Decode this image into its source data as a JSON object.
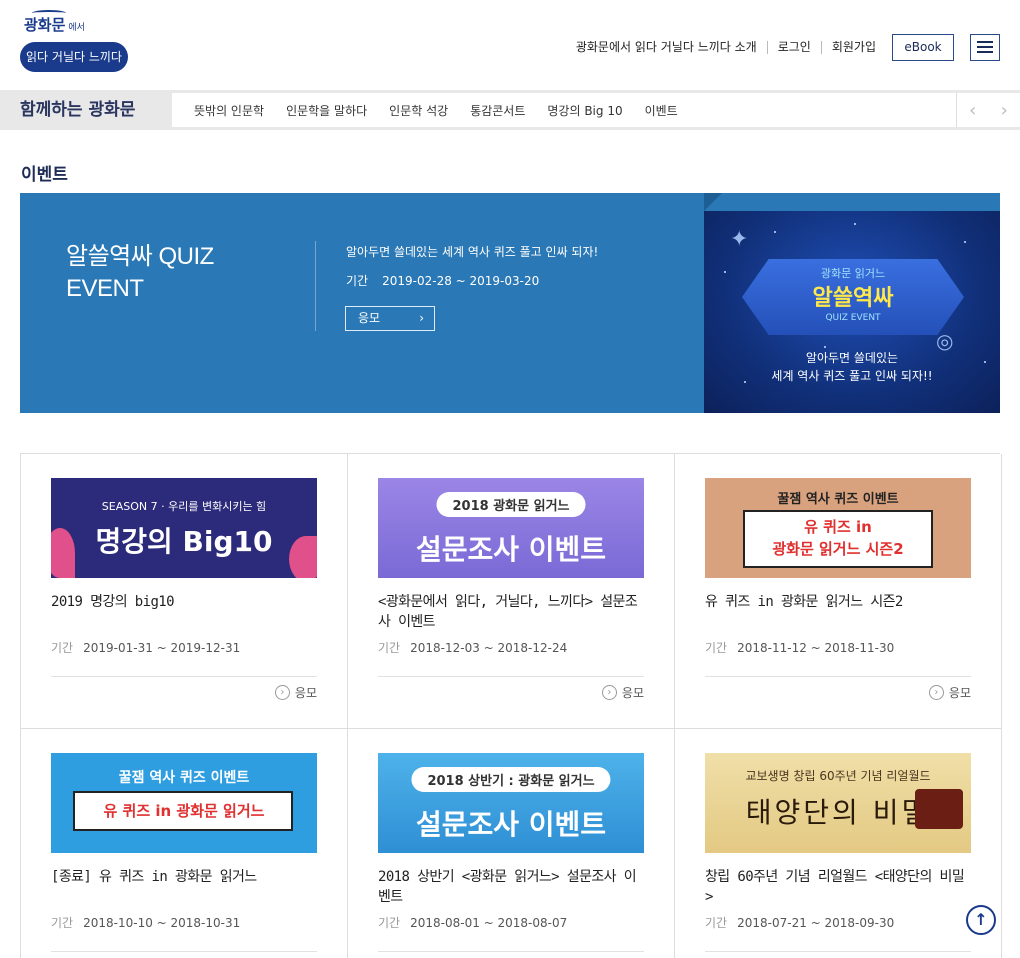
{
  "header": {
    "logo": {
      "line1": "광화문",
      "line1_small": "에서",
      "line2": "읽다 거닐다 느끼다"
    },
    "links": [
      "광화문에서 읽다 거닐다 느끼다 소개",
      "로그인",
      "회원가입"
    ],
    "ebook": "eBook"
  },
  "subnav": {
    "section": "함께하는 광화문",
    "items": [
      "뜻밖의 인문학",
      "인문학을 말하다",
      "인문학 석강",
      "통감콘서트",
      "명강의 Big 10",
      "이벤트"
    ],
    "prev": "‹",
    "next": "›"
  },
  "page_title": "이벤트",
  "banner": {
    "title_line1": "알쓸역싸 QUIZ",
    "title_line2": "EVENT",
    "desc": "알아두면 쓸데있는 세계 역사 퀴즈 풀고 인싸 되자!",
    "period_label": "기간",
    "period": "2019-02-28 ~ 2019-03-20",
    "apply": "응모",
    "visual": {
      "top": "광화문 읽거느",
      "main": "알쓸역싸",
      "sub": "QUIZ EVENT",
      "desc1": "알아두면 쓸데있는",
      "desc2": "세계 역사 퀴즈 풀고 인싸 되자!!"
    }
  },
  "cards": [
    {
      "title": "2019 명강의 big10",
      "period_label": "기간",
      "period": "2019-01-31 ~ 2019-12-31",
      "apply": "응모",
      "thumb": {
        "line1": "SEASON 7 · 우리를 변화시키는 힘",
        "line2": "명강의 Big10"
      }
    },
    {
      "title": "<광화문에서 읽다, 거닐다, 느끼다> 설문조사 이벤트",
      "period_label": "기간",
      "period": "2018-12-03 ~ 2018-12-24",
      "apply": "응모",
      "thumb": {
        "line1": "2018 광화문 읽거느",
        "line2": "설문조사 이벤트"
      }
    },
    {
      "title": "유 퀴즈 in 광화문 읽거느 시즌2",
      "period_label": "기간",
      "period": "2018-11-12 ~ 2018-11-30",
      "apply": "응모",
      "thumb": {
        "line1": "꿀잼 역사 퀴즈 이벤트",
        "line2": "유 퀴즈 in",
        "line3": "광화문 읽거느 시즌2"
      }
    },
    {
      "title": "[종료] 유 퀴즈 in 광화문 읽거느",
      "period_label": "기간",
      "period": "2018-10-10 ~ 2018-10-31",
      "apply": "",
      "thumb": {
        "line1": "꿀잼 역사 퀴즈 이벤트",
        "line2": "유 퀴즈 in 광화문 읽거느"
      }
    },
    {
      "title": "2018 상반기 <광화문 읽거느> 설문조사 이벤트",
      "period_label": "기간",
      "period": "2018-08-01 ~ 2018-08-07",
      "apply": "",
      "thumb": {
        "line1": "2018 상반기 : 광화문 읽거느",
        "line2": "설문조사 이벤트"
      }
    },
    {
      "title": "창립 60주년 기념 리얼월드 <태양단의 비밀>",
      "period_label": "기간",
      "period": "2018-07-21 ~ 2018-09-30",
      "apply": "",
      "thumb": {
        "line1": "교보생명 창립 60주년 기념 리얼월드",
        "line2": "태양단의 비밀"
      }
    }
  ],
  "colors": {
    "navy": "#1a3a8c",
    "banner_blue": "#2a78b6"
  }
}
